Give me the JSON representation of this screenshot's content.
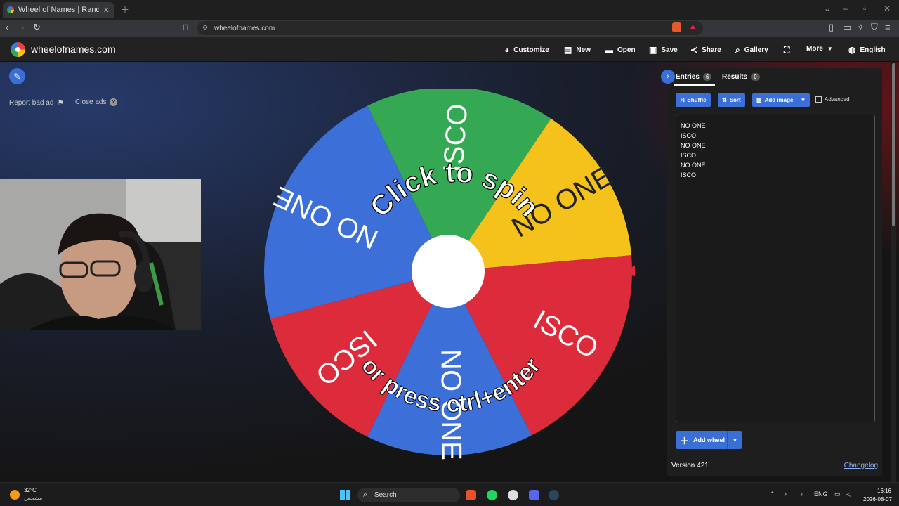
{
  "browser": {
    "tab_title": "Wheel of Names | Random name picker",
    "url": "wheelofnames.com"
  },
  "header": {
    "site_name": "wheelofnames.com",
    "menu": {
      "customize": "Customize",
      "new": "New",
      "open": "Open",
      "save": "Save",
      "share": "Share",
      "gallery": "Gallery",
      "more": "More",
      "language": "English"
    }
  },
  "ads": {
    "report": "Report bad ad",
    "close": "Close ads"
  },
  "wheel": {
    "spin_text_top": "Click to spin",
    "spin_text_bottom": "or press ctrl+enter",
    "segments": [
      {
        "label": "ISCO",
        "color": "#34a853"
      },
      {
        "label": "NO ONE",
        "color": "#f4c21b"
      },
      {
        "label": "ISCO",
        "color": "#dc2b3b"
      },
      {
        "label": "NO ONE",
        "color": "#3c6fd8"
      },
      {
        "label": "ISCO",
        "color": "#dc2b3b"
      },
      {
        "label": "NO ONE",
        "color": "#3c6fd8"
      }
    ]
  },
  "panel": {
    "tab_entries": "Entries",
    "entries_count": "6",
    "tab_results": "Results",
    "results_count": "0",
    "shuffle": "Shuffle",
    "sort": "Sort",
    "add_image": "Add image",
    "advanced": "Advanced",
    "entries": [
      "NO ONE",
      "ISCO",
      "NO ONE",
      "ISCO",
      "NO ONE",
      "ISCO"
    ],
    "add_wheel": "Add wheel",
    "version": "Version 421",
    "changelog": "Changelog"
  },
  "taskbar": {
    "temperature": "32°C",
    "weather_desc": "مشمس",
    "search": "Search",
    "lang": "ENG",
    "time": "16:16",
    "date": "2026-08-07"
  },
  "colors": {
    "accent": "#3b6fd8",
    "pointer": "#dc2b3b"
  }
}
